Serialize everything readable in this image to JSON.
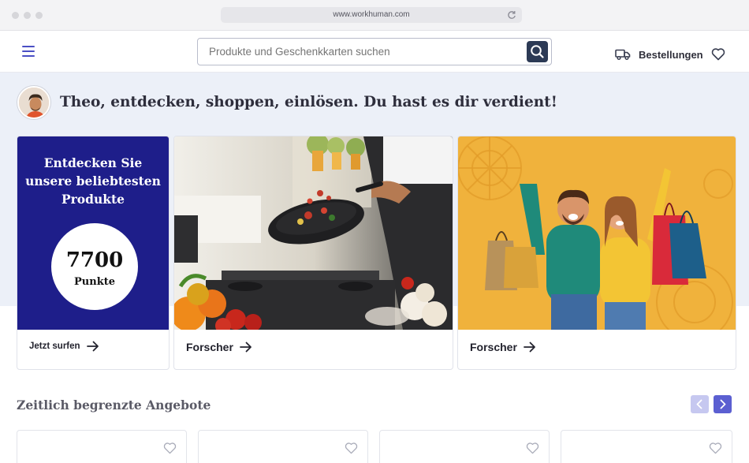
{
  "browser": {
    "url": "www.workhuman.com"
  },
  "header": {
    "search_placeholder": "Produkte und Geschenkkarten suchen",
    "orders_label": "Bestellungen"
  },
  "hero": {
    "greeting": "Theo, entdecken, shoppen, einlösen. Du hast es dir verdient!",
    "cards": [
      {
        "title": "Entdecken Sie unsere beliebtesten Produkte",
        "points_value": "7700",
        "points_label": "Punkte",
        "link": "Jetzt surfen"
      },
      {
        "image": "cooking-scene",
        "link": "Forscher"
      },
      {
        "image": "shopping-couple",
        "link": "Forscher"
      }
    ]
  },
  "offers": {
    "title": "Zeitlich begrenzte Angebote",
    "item_count": 4
  },
  "colors": {
    "accent": "#5b5fd1",
    "promo_bg": "#1e1e8a",
    "hero_bg": "#ecf0f8",
    "search_button": "#2c3a55"
  }
}
